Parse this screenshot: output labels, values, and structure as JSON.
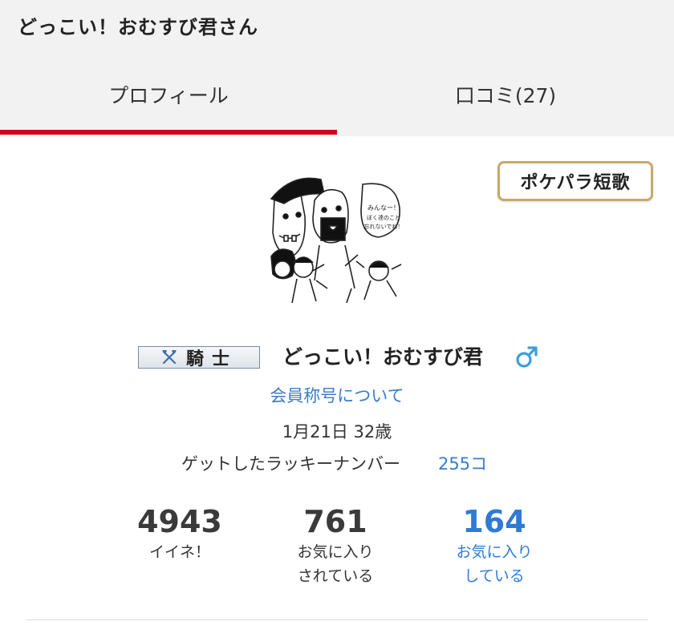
{
  "header": {
    "title": "どっこい！おむすび君さん"
  },
  "tabs": [
    {
      "label": "プロフィール",
      "active": true
    },
    {
      "label": "口コミ(27)",
      "active": false
    }
  ],
  "colors": {
    "accent": "#d0021b",
    "link": "#3a7cc8",
    "tanka_border": "#c9a86a"
  },
  "tanka_button": {
    "label": "ポケパラ短歌"
  },
  "avatar": {
    "icon": "manga-illustration-avatar",
    "speech_text": "みんなー！ぼく達のこと忘れないでね！"
  },
  "profile": {
    "rank_icon": "crossed-axes-icon",
    "rank": "騎士",
    "name": "どっこい！おむすび君",
    "gender_icon": "male-icon",
    "title_link": "会員称号について",
    "birthday_age": "1月21日 32歳",
    "lucky_label": "ゲットしたラッキーナンバー",
    "lucky_count": "255コ"
  },
  "stats": [
    {
      "value": "4943",
      "line1": "イイネ！",
      "line2": ""
    },
    {
      "value": "761",
      "line1": "お気に入り",
      "line2": "されている"
    },
    {
      "value": "164",
      "line1": "お気に入り",
      "line2": "している"
    }
  ]
}
